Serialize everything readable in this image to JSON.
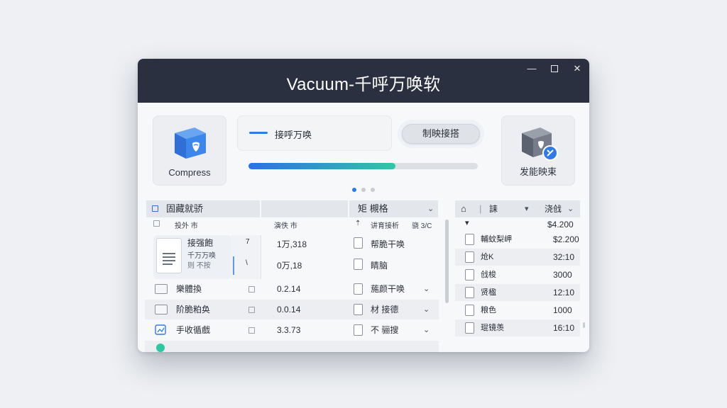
{
  "window": {
    "title": "Vacuum-千呼万唤软"
  },
  "tiles": {
    "left_label": "Compress",
    "right_label": "发能映束"
  },
  "task": {
    "label": "接呼万唤",
    "action": "制映接搭"
  },
  "progress": {
    "value": 0.64
  },
  "pager": {
    "count": 3,
    "active": 0
  },
  "left_panel": {
    "header_title": "固藏就骄",
    "header_col3": "矩 槻格",
    "sub_col1": "投外 市",
    "sub_col2": "演佚 市",
    "sub_col3": "讲育接析",
    "sub_col4": "骁 3/C",
    "featured": {
      "title": "接强飽",
      "line1": "千万万唤",
      "line2": "则 不按",
      "values": [
        {
          "flag": "7",
          "size": "1万,318",
          "type": "帮脆干唤"
        },
        {
          "flag": "\\",
          "size": "0万,18",
          "type": "睛脑"
        }
      ]
    },
    "rows": [
      {
        "name": "樂體換",
        "size": "0.2.14",
        "type": "葹颜干唤"
      },
      {
        "name": "阶脆粕奂",
        "size": "0.0.14",
        "type": "材 接德"
      },
      {
        "name": "手收循戲",
        "size": "3.3.73",
        "type": "不 骊搜"
      }
    ]
  },
  "right_panel": {
    "header_col1": "誄",
    "header_col2": "浇戗",
    "top_value": "$4.200",
    "rows": [
      {
        "name": "輔蚊梨岬",
        "value": "$2.200"
      },
      {
        "name": "炝K",
        "value": "32:10"
      },
      {
        "name": "戗梭",
        "value": "3000"
      },
      {
        "name": "贤楹",
        "value": "12:10"
      },
      {
        "name": "粮色",
        "value": "1000"
      },
      {
        "name": "琨镜羡",
        "value": "16:10"
      }
    ]
  }
}
